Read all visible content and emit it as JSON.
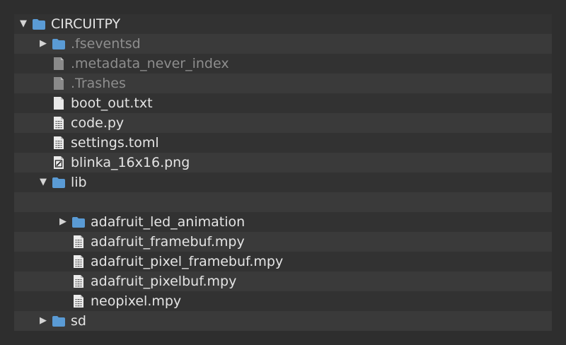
{
  "tree": {
    "rows": [
      {
        "label": "CIRCUITPY",
        "depth": 0,
        "expander": "expanded",
        "icon": "folder-icon",
        "dim": false,
        "stripe": false
      },
      {
        "label": ".fseventsd",
        "depth": 1,
        "expander": "collapsed",
        "icon": "folder-icon",
        "dim": true,
        "stripe": true
      },
      {
        "label": ".metadata_never_index",
        "depth": 1,
        "expander": "none",
        "icon": "file-icon",
        "dim": true,
        "stripe": false
      },
      {
        "label": ".Trashes",
        "depth": 1,
        "expander": "none",
        "icon": "file-icon",
        "dim": true,
        "stripe": true
      },
      {
        "label": "boot_out.txt",
        "depth": 1,
        "expander": "none",
        "icon": "text-file-icon",
        "dim": false,
        "stripe": false
      },
      {
        "label": "code.py",
        "depth": 1,
        "expander": "none",
        "icon": "code-file-icon",
        "dim": false,
        "stripe": true
      },
      {
        "label": "settings.toml",
        "depth": 1,
        "expander": "none",
        "icon": "code-file-icon",
        "dim": false,
        "stripe": false
      },
      {
        "label": "blinka_16x16.png",
        "depth": 1,
        "expander": "none",
        "icon": "image-file-icon",
        "dim": false,
        "stripe": true
      },
      {
        "label": "lib",
        "depth": 1,
        "expander": "expanded",
        "icon": "folder-icon",
        "dim": false,
        "stripe": false
      },
      {
        "label": "",
        "depth": 2,
        "expander": "none",
        "icon": "none",
        "dim": false,
        "stripe": true
      },
      {
        "label": "adafruit_led_animation",
        "depth": 2,
        "expander": "collapsed",
        "icon": "folder-icon",
        "dim": false,
        "stripe": false
      },
      {
        "label": "adafruit_framebuf.mpy",
        "depth": 2,
        "expander": "none",
        "icon": "code-file-icon",
        "dim": false,
        "stripe": true
      },
      {
        "label": "adafruit_pixel_framebuf.mpy",
        "depth": 2,
        "expander": "none",
        "icon": "code-file-icon",
        "dim": false,
        "stripe": false
      },
      {
        "label": "adafruit_pixelbuf.mpy",
        "depth": 2,
        "expander": "none",
        "icon": "code-file-icon",
        "dim": false,
        "stripe": true
      },
      {
        "label": "neopixel.mpy",
        "depth": 2,
        "expander": "none",
        "icon": "code-file-icon",
        "dim": false,
        "stripe": false
      },
      {
        "label": "sd",
        "depth": 1,
        "expander": "collapsed",
        "icon": "folder-icon",
        "dim": false,
        "stripe": true
      }
    ]
  },
  "colors": {
    "folder": "#5a9bd5",
    "file": "#e8e8e8",
    "file_dim": "#8a8a8a",
    "text": "#e4e4e4",
    "text_dim": "#8e8e8e"
  }
}
